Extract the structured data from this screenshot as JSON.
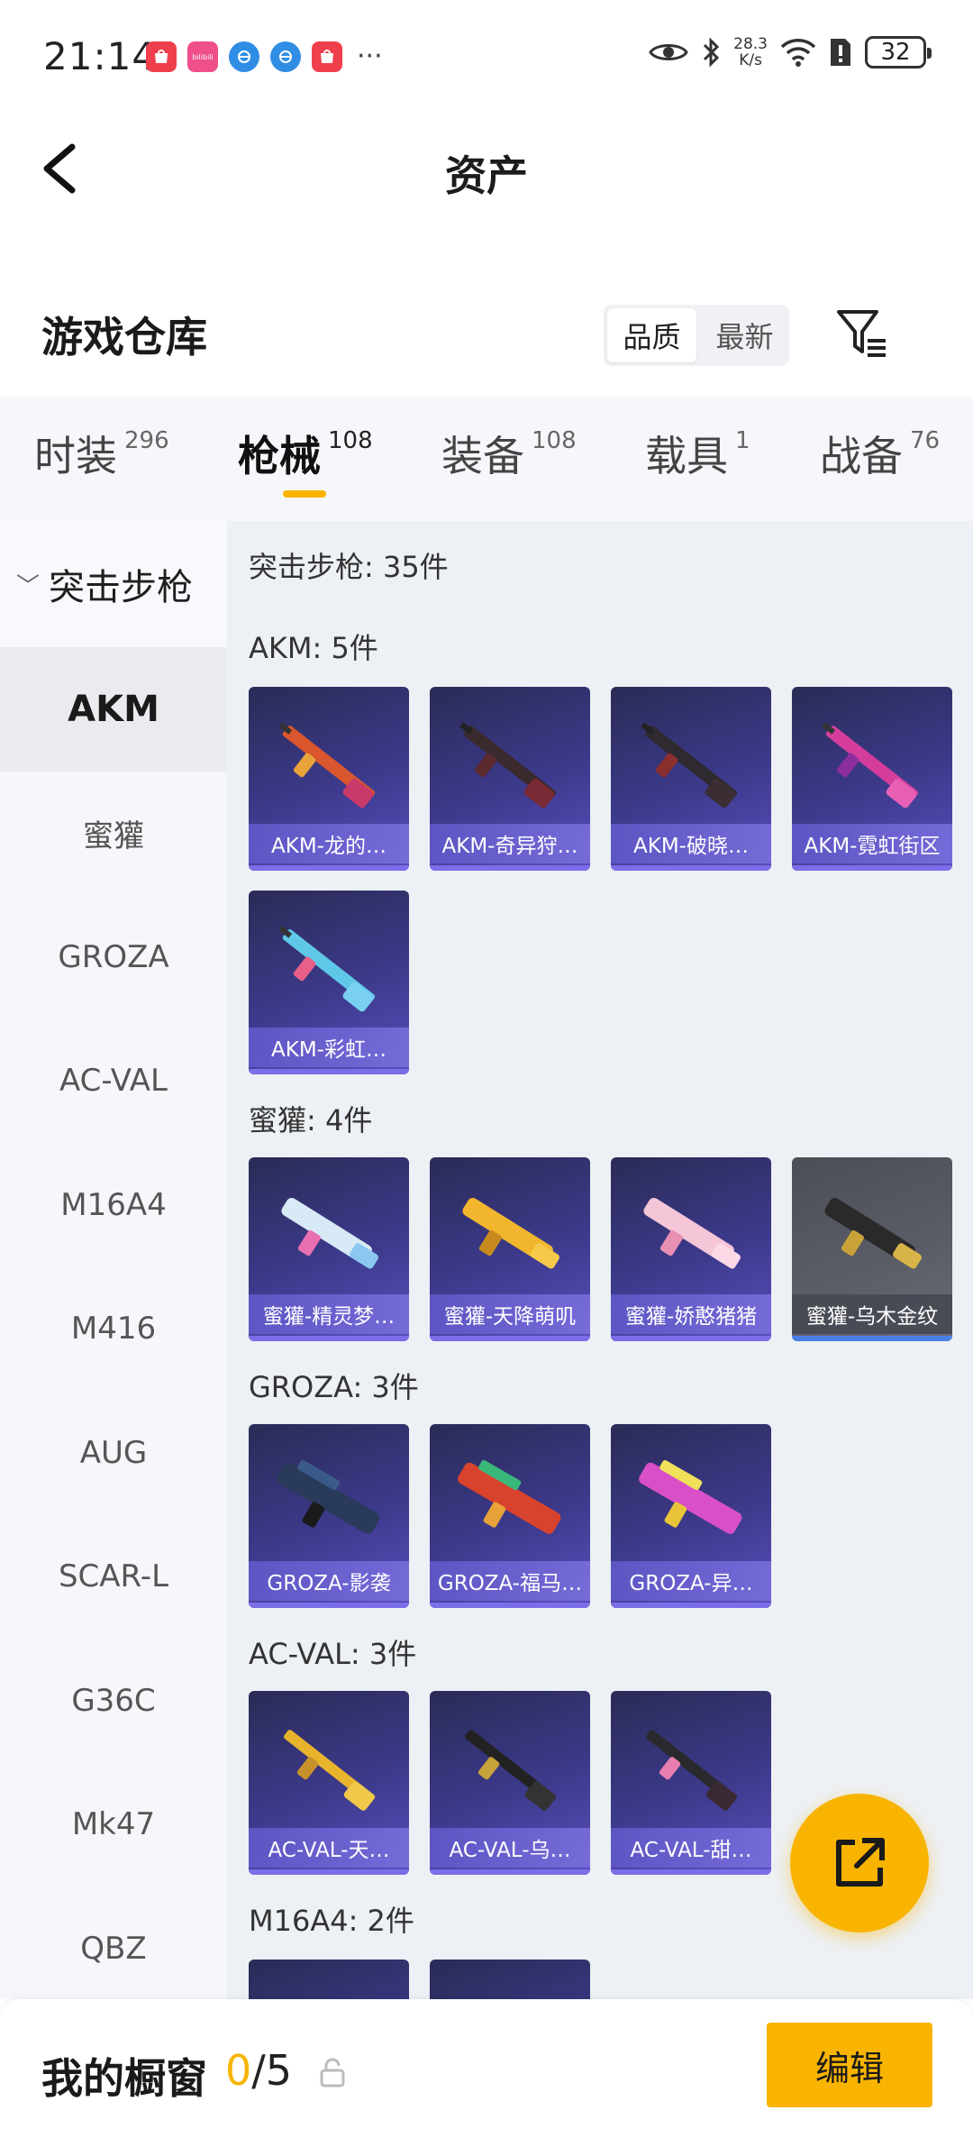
{
  "status_bar": {
    "time": "21:14",
    "speed_value": "28.3",
    "speed_unit": "K/s",
    "battery": "32",
    "more": "···",
    "app_badge_text": "bilibili"
  },
  "header": {
    "title": "资产"
  },
  "warehouse": {
    "title": "游戏仓库",
    "sort_options": [
      "品质",
      "最新"
    ],
    "sort_selected": "品质"
  },
  "tabs": [
    {
      "label": "时装",
      "count": "296"
    },
    {
      "label": "枪械",
      "count": "108"
    },
    {
      "label": "装备",
      "count": "108"
    },
    {
      "label": "载具",
      "count": "1"
    },
    {
      "label": "战备",
      "count": "76"
    }
  ],
  "active_tab": "枪械",
  "sidebar": {
    "group": "突击步枪",
    "items": [
      "AKM",
      "蜜獾",
      "GROZA",
      "AC-VAL",
      "M16A4",
      "M416",
      "AUG",
      "SCAR-L",
      "G36C",
      "Mk47",
      "QBZ"
    ],
    "active": "AKM"
  },
  "content": {
    "group_title": "突击步枪: 35件",
    "sections": [
      {
        "title": "AKM: 5件",
        "items": [
          "AKM-龙的…",
          "AKM-奇异狩…",
          "AKM-破晓…",
          "AKM-霓虹街区",
          "AKM-彩虹…"
        ]
      },
      {
        "title": "蜜獾: 4件",
        "items": [
          "蜜獾-精灵梦…",
          "蜜獾-天降萌叽",
          "蜜獾-娇憨猪猪",
          "蜜獾-乌木金纹"
        ]
      },
      {
        "title": "GROZA: 3件",
        "items": [
          "GROZA-影袭",
          "GROZA-福马…",
          "GROZA-异…"
        ]
      },
      {
        "title": "AC-VAL: 3件",
        "items": [
          "AC-VAL-天…",
          "AC-VAL-乌…",
          "AC-VAL-甜…"
        ]
      },
      {
        "title": "M16A4: 2件",
        "items": [
          "",
          ""
        ]
      }
    ]
  },
  "colors": {
    "accent": "#f8b400",
    "card_purple": "#3d3a8c",
    "card_gray": "#5b5d67"
  },
  "icons": {
    "back": "chevron-left-icon",
    "filter": "filter-icon",
    "share": "share-external-icon",
    "lock": "lock-icon"
  },
  "bottom_bar": {
    "title": "我的橱窗",
    "used": "0",
    "total": "/5",
    "edit_label": "编辑"
  }
}
